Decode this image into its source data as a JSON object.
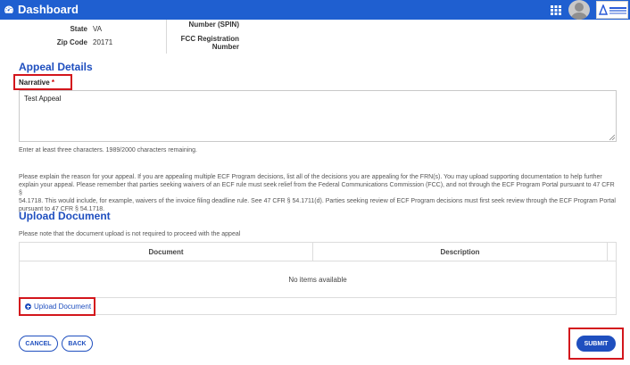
{
  "header": {
    "title": "Dashboard",
    "icons": [
      "dashboard-icon",
      "apps-grid-icon",
      "user-avatar",
      "org-logo"
    ]
  },
  "summary": {
    "state_label": "State",
    "state_value": "VA",
    "zip_label": "Zip Code",
    "zip_value": "20171",
    "spin_label": "Number (SPIN)",
    "fcc_label_line1": "FCC Registration",
    "fcc_label_line2": "Number"
  },
  "appeal_details": {
    "title": "Appeal Details",
    "narrative_label": "Narrative",
    "required_mark": "*",
    "narrative_value": "Test Appeal",
    "char_hint": "Enter at least three characters. 1989/2000 characters remaining.",
    "instructions": [
      "Please explain the reason for your appeal. If you are appealing multiple ECF Program decisions, list all of the decisions you are appealing for the FRN(s). You may upload supporting documentation to help further",
      "explain your appeal. Please remember that parties seeking waivers of an ECF rule must seek relief from the Federal Communications Commission (FCC), and not through the ECF Program Portal pursuant to 47 CFR §",
      "54.1718. This would include, for example, waivers of the invoice filing deadline rule. See 47 CFR § 54.1711(d). Parties seeking review of ECF Program decisions must first seek review through the ECF Program Portal",
      "pursuant to 47 CFR § 54.1718."
    ]
  },
  "upload": {
    "title": "Upload Document",
    "note": "Please note that the document upload is not required to proceed with the appeal",
    "columns": [
      "Document",
      "Description"
    ],
    "empty_text": "No items available",
    "link_label": "Upload Document"
  },
  "actions": {
    "cancel": "CANCEL",
    "back": "BACK",
    "submit": "SUBMIT"
  },
  "colors": {
    "brand": "#1f5fd0",
    "accent": "#1f4fbf",
    "highlight": "#d3161c"
  }
}
